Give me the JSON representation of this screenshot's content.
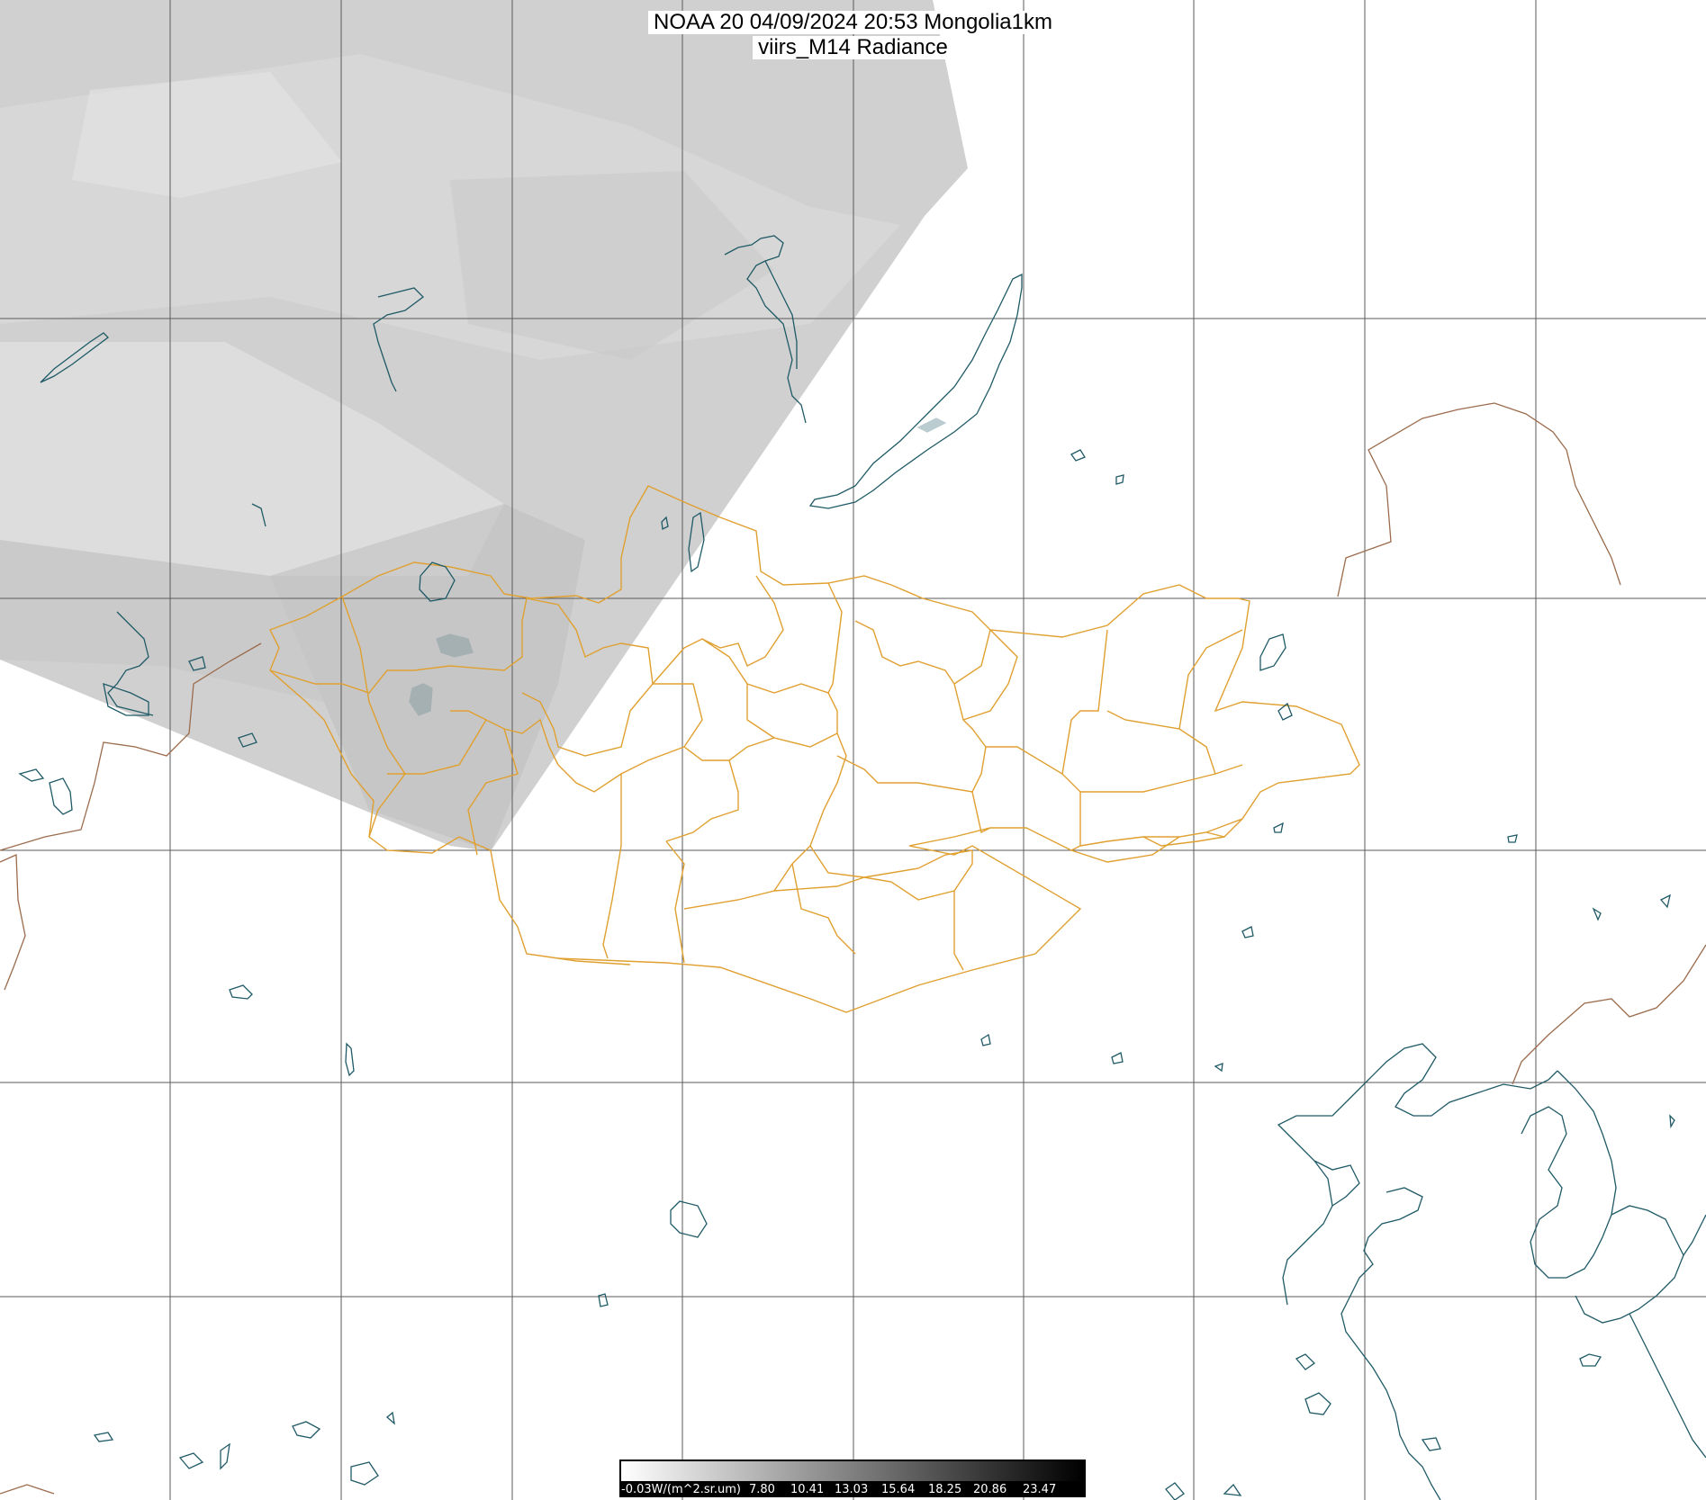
{
  "title": {
    "line1": "NOAA 20 04/09/2024 20:53 Mongolia1km",
    "line2": "viirs_M14 Radiance"
  },
  "legend": {
    "labels": [
      "-0.03W/(m^2.sr.um)",
      "7.80",
      "10.41",
      "13.03",
      "15.64",
      "18.25",
      "20.86",
      "23.47"
    ],
    "gradient_start": "#ffffff",
    "gradient_end": "#000000"
  },
  "colors": {
    "imagery": "#cfcfcf",
    "grid": "#5a5a5a",
    "coast_water": "#1f5a66",
    "international_border": "#9b6b4c",
    "mongolia_province_border": "#e0a030"
  }
}
